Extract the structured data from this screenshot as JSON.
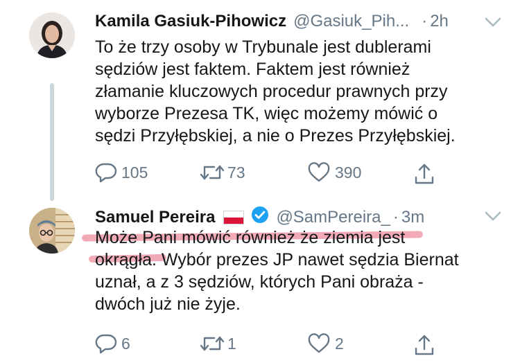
{
  "tweets": [
    {
      "author": "Kamila Gasiuk-Pihowicz",
      "handle": "@Gasiuk_Pih...",
      "dot": "·",
      "time": "2h",
      "lines": [
        "To że trzy osoby w Trybunale jest dublerami",
        "sędziów jest faktem. Faktem jest również",
        "złamanie kluczowych procedur prawnych przy",
        "wyborze Prezesa TK, więc możemy mówić o",
        "sędzi Przyłębskiej, a nie o Prezes Przyłębskiej."
      ],
      "replies": "105",
      "retweets": "73",
      "likes": "390"
    },
    {
      "author": "Samuel Pereira",
      "handle": "@SamPereira_",
      "dot": "·",
      "time": "3m",
      "lines": [
        "Może Pani mówić również że ziemia jest",
        "okrągła. Wybór prezes JP nawet sędzia Biernat",
        "uznał, a z 3 sędziów, których Pani obraża -",
        "dwóch już nie żyje."
      ],
      "replies": "6",
      "retweets": "1",
      "likes": "2"
    }
  ],
  "icons": {
    "reply": "reply-icon",
    "retweet": "retweet-icon",
    "like": "heart-icon",
    "share": "share-icon",
    "menu": "chevron-down-icon",
    "verified": "verified-badge-icon",
    "flag": "poland-flag-icon"
  },
  "colors": {
    "text": "#14171a",
    "muted": "#657786",
    "verified": "#1da1f2",
    "highlight": "#e8667a",
    "thread_line": "#ccd6dd"
  }
}
